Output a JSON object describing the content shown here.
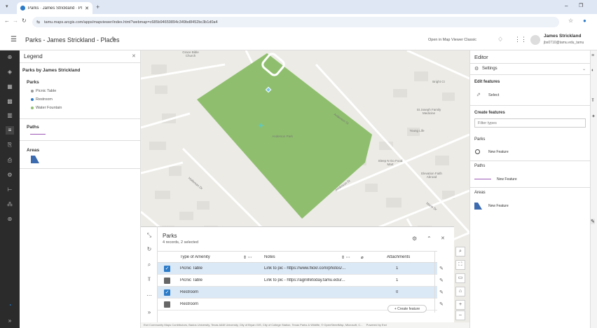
{
  "browser": {
    "tab_title": "Parks - James Strickland - Places",
    "tab_title_short": "Parks · James Strickland · Place",
    "url": "tamu.maps.arcgis.com/apps/mapviewer/index.html?webmap=c685b94659894c349bd8452bc3b1d0a4"
  },
  "header": {
    "title": "Parks - James Strickland - Places",
    "open_classic": "Open in Map Viewer Classic",
    "user_name": "James Strickland",
    "user_id": "jbs0710@tamu.edu_tamu"
  },
  "legend": {
    "title": "Legend",
    "layer_title": "Parks by James Strickland",
    "groups": [
      {
        "title": "Parks",
        "items": [
          "Picnic Table",
          "Restroom",
          "Water Fountain"
        ]
      },
      {
        "title": "Paths"
      },
      {
        "title": "Areas"
      }
    ]
  },
  "map": {
    "labels": [
      "Grace Bible Church",
      "Anderson Park",
      "Bright Ct",
      "St Joseph Family Medicine",
      "Young Life",
      "Anderson St",
      "Sleep N Go Food Mart",
      "Elevation Faith Abroad",
      "Holleman Dr",
      "Marie Dr",
      "Anderson St"
    ]
  },
  "table": {
    "title": "Parks",
    "subtitle": "4 records, 2 selected",
    "columns": [
      "Type of Amenity",
      "Notes",
      "Attachments"
    ],
    "rows": [
      {
        "type": "Picnic Table",
        "notes": "Link to pic - https://www.flickr.com/photos/...",
        "attachments": "1",
        "selected": true
      },
      {
        "type": "Picnic Table",
        "notes": "Link to pic - https://agrilifetoday.tamu.edu/...",
        "attachments": "1",
        "selected": false
      },
      {
        "type": "Restroom",
        "notes": "",
        "attachments": "0",
        "selected": true
      },
      {
        "type": "Restroom",
        "notes": "",
        "attachments": "",
        "selected": false
      }
    ],
    "create_feature": "Create feature"
  },
  "editor": {
    "title": "Editor",
    "settings": "Settings",
    "edit_features": "Edit features",
    "select": "Select",
    "create_features": "Create features",
    "filter_placeholder": "Filter types",
    "groups": [
      {
        "title": "Parks",
        "item": "New Feature"
      },
      {
        "title": "Paths",
        "item": "New Feature"
      },
      {
        "title": "Areas",
        "item": "New Feature"
      }
    ]
  },
  "attribution": "Esri Community Maps Contributors, Bados University, Texas A&M University, City of Bryan GIS, City of College Station, Texas Parks & Wildlife, © OpenStreetMap, Microsoft, C...",
  "powered_by": "Powered by Esri",
  "colors": {
    "accent": "#2b7bc8",
    "park_fill": "#8fbf6e",
    "sidebar_dark": "#2b2b2b",
    "path_line": "#9b59b6",
    "area_fill": "#3d6bb0"
  }
}
